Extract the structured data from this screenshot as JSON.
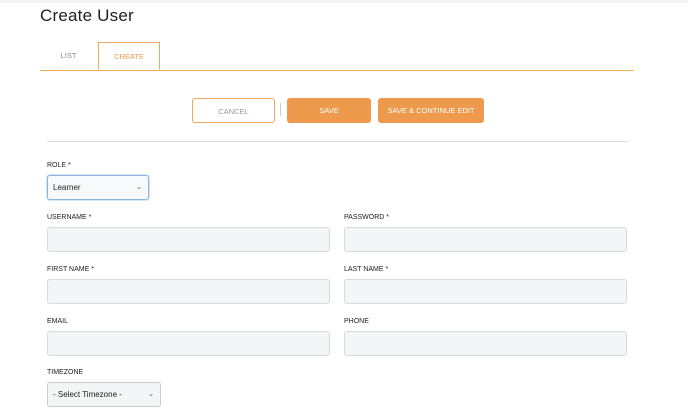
{
  "page": {
    "title": "Create User"
  },
  "tabs": [
    {
      "label": "LIST",
      "active": false
    },
    {
      "label": "CREATE",
      "active": true
    }
  ],
  "actions": {
    "cancel_label": "CANCEL",
    "save_label": "SAVE",
    "save_continue_label": "SAVE & CONTINUE EDIT"
  },
  "form": {
    "role": {
      "label": "ROLE *",
      "value": "Learner"
    },
    "username": {
      "label": "USERNAME *",
      "value": ""
    },
    "password": {
      "label": "PASSWORD *",
      "value": ""
    },
    "first_name": {
      "label": "FIRST NAME *",
      "value": ""
    },
    "last_name": {
      "label": "LAST NAME *",
      "value": ""
    },
    "email": {
      "label": "EMAIL",
      "value": ""
    },
    "phone": {
      "label": "PHONE",
      "value": ""
    },
    "timezone": {
      "label": "TIMEZONE",
      "value": "- Select Timezone -"
    }
  },
  "icons": {
    "dropdown": "chevron-down-icon"
  },
  "colors": {
    "accent": "#ee9a4c",
    "accent_border": "#f0a95a",
    "input_bg": "#f4f5f7",
    "focus": "#8fb4dc"
  }
}
